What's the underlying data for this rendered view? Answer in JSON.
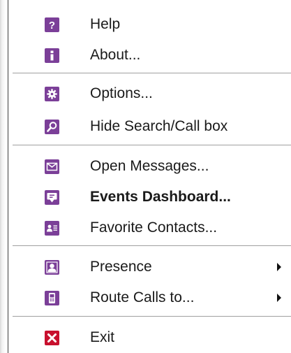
{
  "menu": {
    "colors": {
      "icon_purple": "#7b3f98",
      "icon_exit_red": "#c8102e",
      "separator": "#a0a0a0",
      "text": "#1a1a1a"
    },
    "groups": [
      {
        "items": [
          {
            "label": "Help",
            "icon": "help-icon"
          },
          {
            "label": "About...",
            "icon": "info-icon"
          }
        ]
      },
      {
        "items": [
          {
            "label": "Options...",
            "icon": "gear-icon"
          },
          {
            "label": "Hide Search/Call box",
            "icon": "search-icon"
          }
        ]
      },
      {
        "items": [
          {
            "label": "Open Messages...",
            "icon": "envelope-icon"
          },
          {
            "label": "Events Dashboard...",
            "icon": "dashboard-icon",
            "bold": true
          },
          {
            "label": "Favorite Contacts...",
            "icon": "contact-card-icon"
          }
        ]
      },
      {
        "items": [
          {
            "label": "Presence",
            "icon": "presence-icon",
            "submenu": true
          },
          {
            "label": "Route Calls to...",
            "icon": "phone-route-icon",
            "submenu": true
          }
        ]
      },
      {
        "items": [
          {
            "label": "Exit",
            "icon": "exit-icon"
          }
        ]
      }
    ]
  }
}
